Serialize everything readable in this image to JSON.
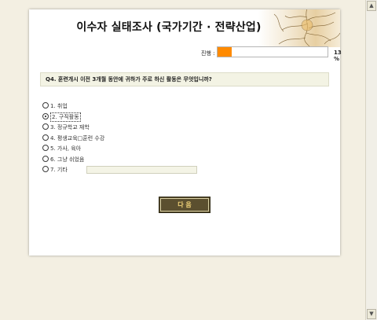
{
  "survey": {
    "title": "이수자 실태조사 (국가기간 · 전략산업)",
    "progress": {
      "label": "진행 :",
      "percent_text": "13 %",
      "value": 0.13
    },
    "question": "Q4. 훈련개시 이전 3개월 동안에 귀하가 주로 하신 활동은 무엇입니까?",
    "options": [
      {
        "label": "1. 취업",
        "checked": false
      },
      {
        "label": "2. 구직활동",
        "checked": true
      },
      {
        "label": "3. 정규학교 재학",
        "checked": false
      },
      {
        "label": "4. 평생교육□훈련 수강",
        "checked": false
      },
      {
        "label": "5. 가사, 육아",
        "checked": false
      },
      {
        "label": "6. 그냥 쉬었음",
        "checked": false
      },
      {
        "label": "7. 기타",
        "checked": false,
        "has_input": true
      }
    ],
    "other_input_value": "",
    "next_button": "다 음"
  },
  "colors": {
    "progress": "#ff8a00",
    "button_bg": "#5b4f2f",
    "button_text": "#f2d47a",
    "page_bg": "#f3efe2"
  }
}
